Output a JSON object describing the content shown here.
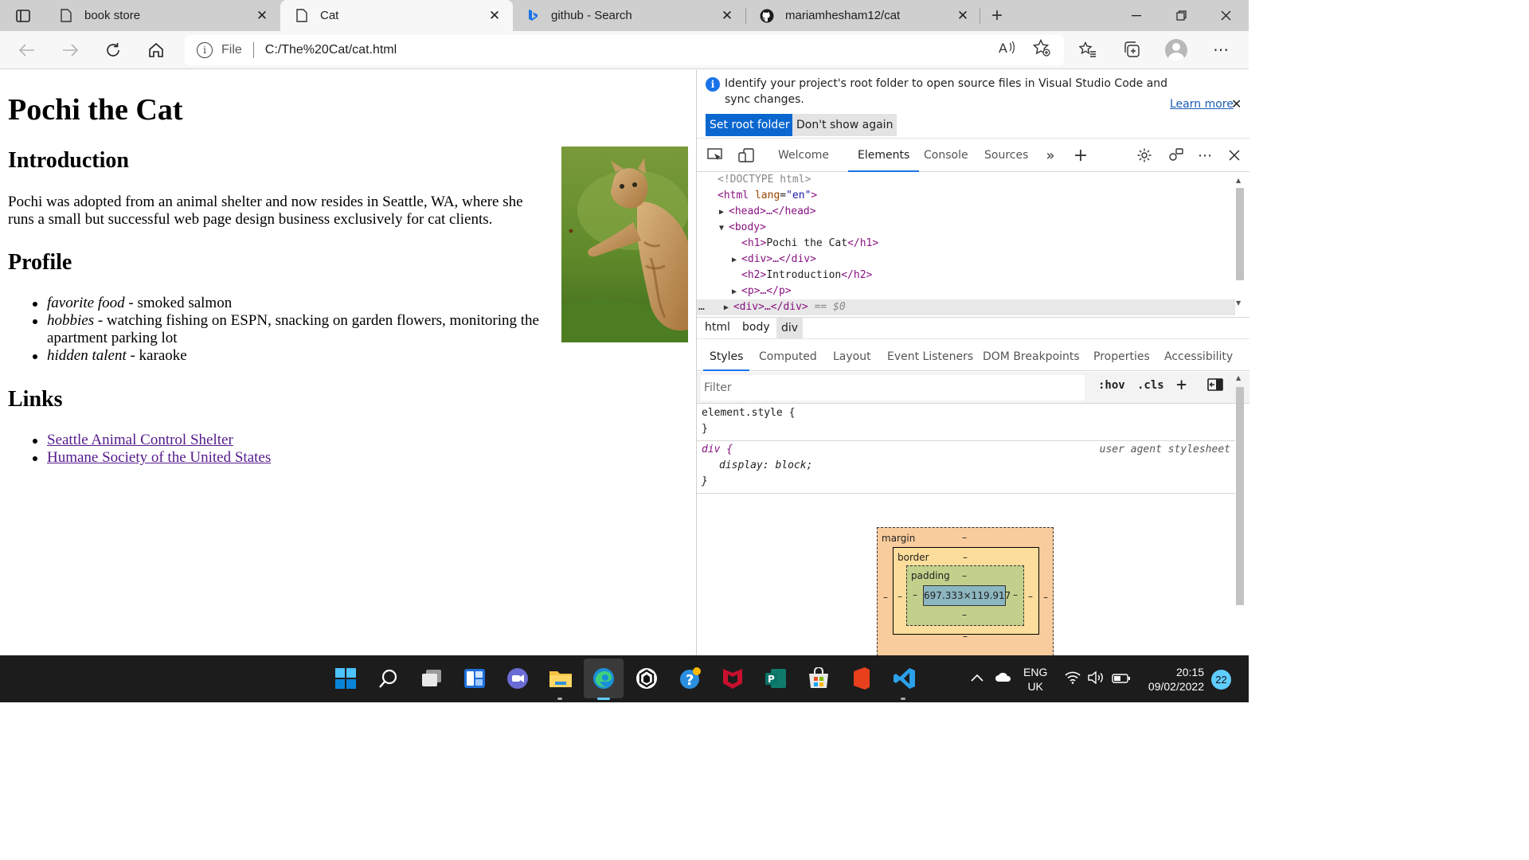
{
  "browser": {
    "tabs": [
      {
        "title": "book store",
        "icon": "page-icon",
        "active": false
      },
      {
        "title": "Cat",
        "icon": "page-icon",
        "active": true
      },
      {
        "title": "github - Search",
        "icon": "bing-icon",
        "active": false
      },
      {
        "title": "mariamhesham12/cat",
        "icon": "github-icon",
        "active": false
      }
    ],
    "address": {
      "scheme": "File",
      "url": "C:/The%20Cat/cat.html"
    }
  },
  "page": {
    "title": "Pochi the Cat",
    "intro_heading": "Introduction",
    "intro_text": "Pochi was adopted from an animal shelter and now resides in Seattle, WA, where she runs a small but successful web page design business exclusively for cat clients.",
    "profile_heading": "Profile",
    "profile_items": [
      {
        "label": "favorite food",
        "value": " - smoked salmon"
      },
      {
        "label": "hobbies",
        "value": " - watching fishing on ESPN, snacking on garden flowers, monitoring the apartment parking lot"
      },
      {
        "label": "hidden talent",
        "value": " - karaoke"
      }
    ],
    "links_heading": "Links",
    "links": [
      "Seattle Animal Control Shelter",
      "Humane Society of the United States"
    ]
  },
  "devtools": {
    "infobar": {
      "message": "Identify your project's root folder to open source files in Visual Studio Code and sync changes.",
      "learn_more": "Learn more",
      "set_root": "Set root folder",
      "dont_show": "Don't show again"
    },
    "tabs": [
      "Welcome",
      "Elements",
      "Console",
      "Sources"
    ],
    "active_tab": "Elements",
    "dom": {
      "doctype": "<!DOCTYPE html>",
      "html_open": "<html",
      "lang_attr": "lang",
      "lang_val": "\"en\"",
      "head": "<head>…</head>",
      "body": "<body>",
      "h1_open": "<h1>",
      "h1_text": "Pochi the Cat",
      "h1_close": "</h1>",
      "div": "<div>…</div>",
      "h2_open": "<h2>",
      "h2_text": "Introduction",
      "h2_close": "</h2>",
      "p": "<p>…</p>",
      "selected": "<div>…</div>",
      "selected_marker": "== $0",
      "gt": ">",
      "ellipsis": "…"
    },
    "breadcrumbs": [
      "html",
      "body",
      "div"
    ],
    "style_tabs": [
      "Styles",
      "Computed",
      "Layout",
      "Event Listeners",
      "DOM Breakpoints",
      "Properties",
      "Accessibility"
    ],
    "filter_placeholder": "Filter",
    "hov": ":hov",
    "cls": ".cls",
    "rules": {
      "element_style": "element.style {",
      "close_brace": "}",
      "div_selector": "div {",
      "div_source": "user agent stylesheet",
      "prop_name": "display",
      "prop_value": "block;"
    },
    "box_model": {
      "margin_label": "margin",
      "border_label": "border",
      "padding_label": "padding",
      "dash": "–",
      "content_size": "697.333×119.917"
    }
  },
  "taskbar": {
    "lang": "ENG",
    "region": "UK",
    "time": "20:15",
    "date": "09/02/2022",
    "notifications": "22"
  }
}
